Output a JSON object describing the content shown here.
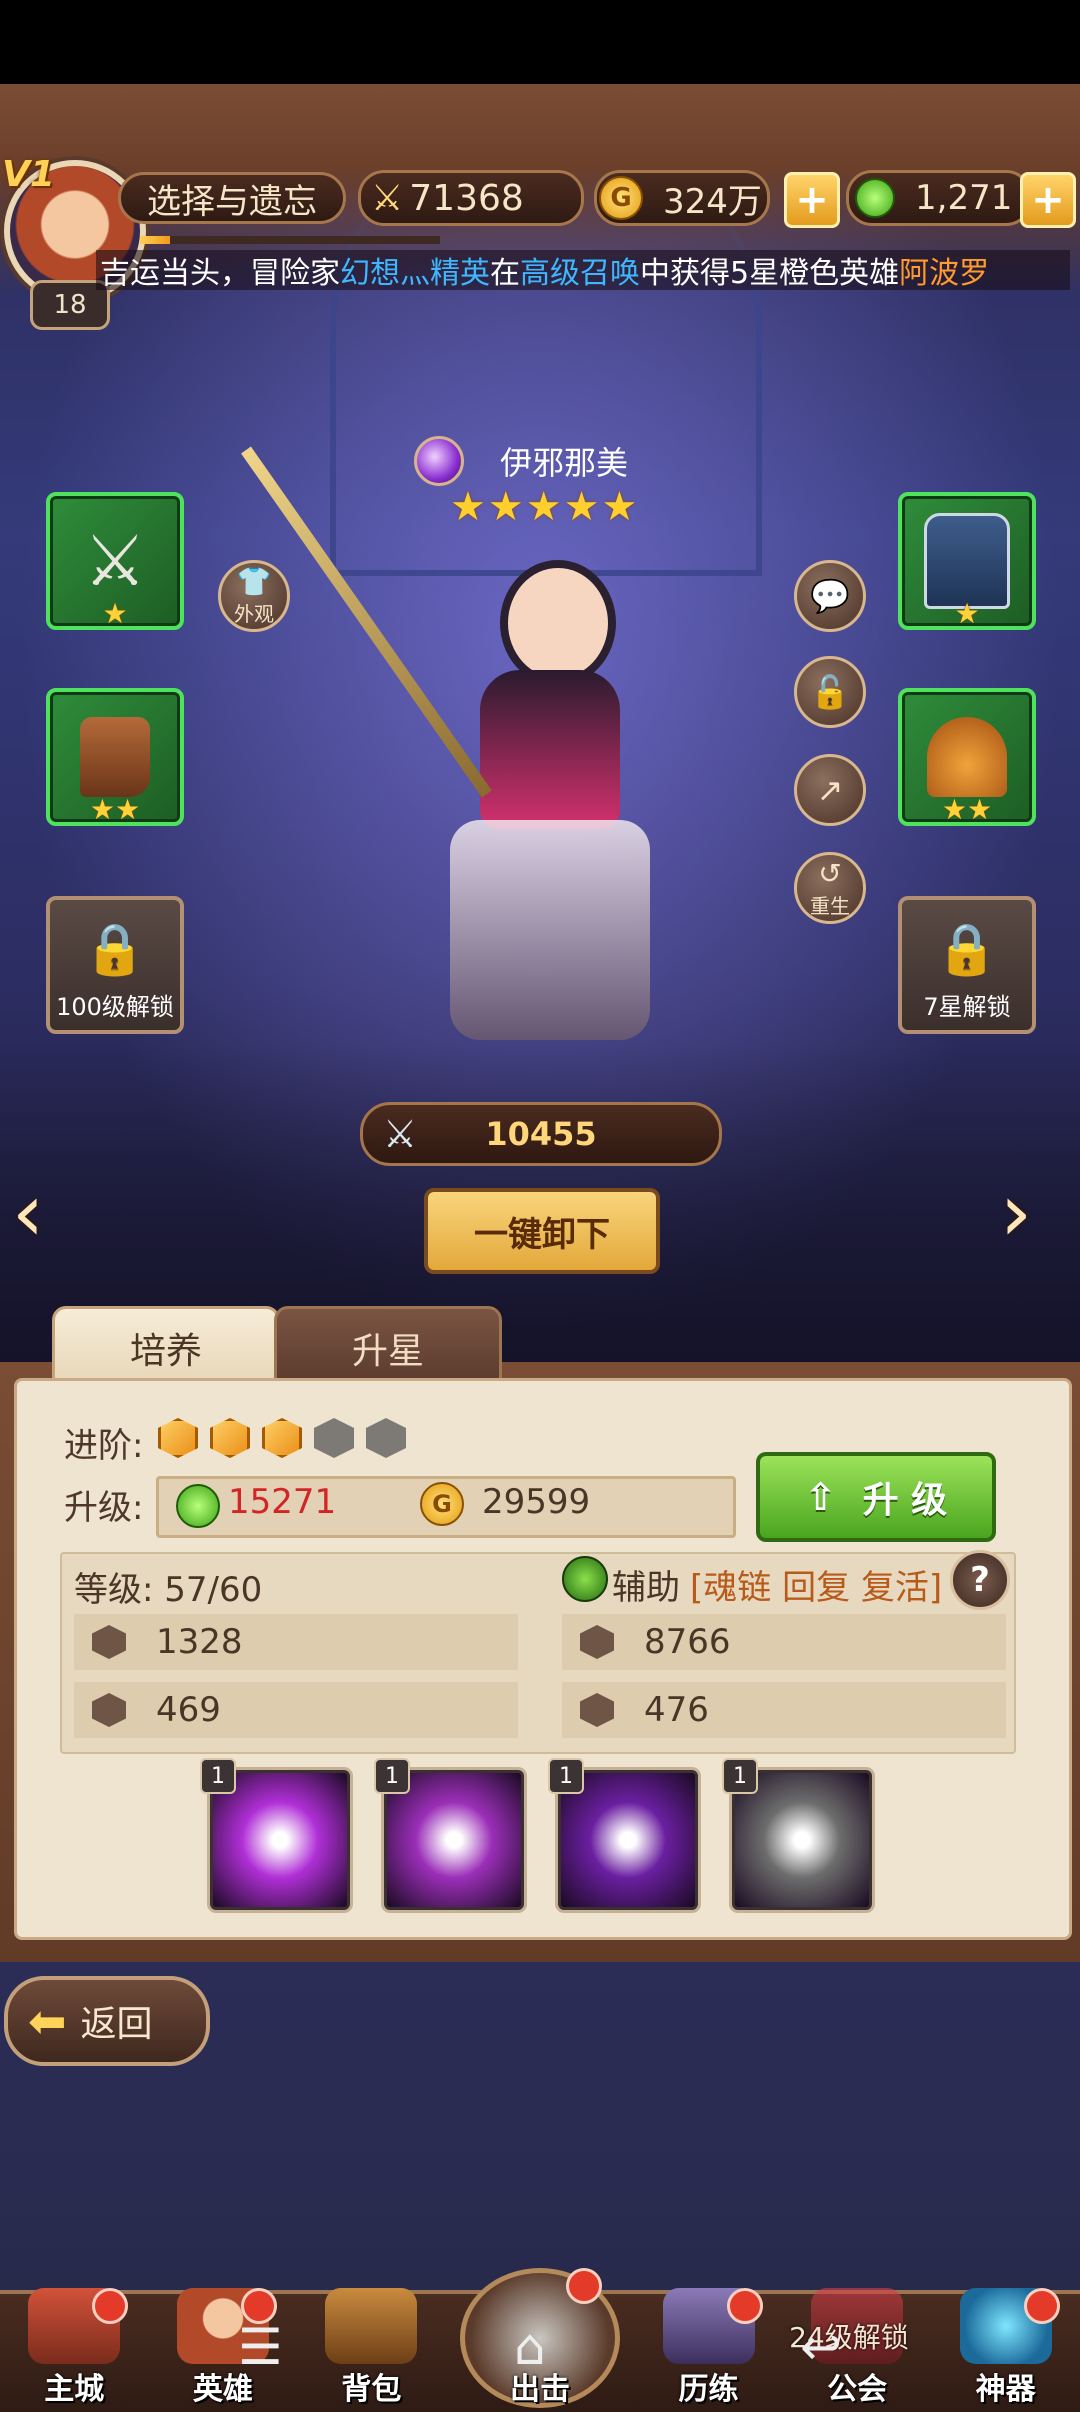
{
  "player": {
    "vip": "V1",
    "level": "18",
    "server_button": "选择与遗忘",
    "power": "71368",
    "gold": "324万",
    "potion": "1,271",
    "exp_fraction": 0.1
  },
  "marquee": {
    "prefix": "吉运当头，冒险家",
    "player_name": "幻想灬精英",
    "in_text": "在",
    "event": "高级召唤",
    "middle": "中获得5星橙色英雄",
    "hero": "阿波罗"
  },
  "hero": {
    "name": "伊邪那美",
    "stars": "★★★★★",
    "skin_button": "外观",
    "rebirth_label": "重生",
    "power": "10455",
    "unload_button": "一键卸下",
    "slot_lock_left": "100级解锁",
    "slot_lock_right": "7星解锁",
    "weapon_stars": "★",
    "armor_stars": "★",
    "boots_stars": "★★",
    "helmet_stars": "★★"
  },
  "tabs": [
    "培养",
    "升星"
  ],
  "panel": {
    "advance_label": "进阶:",
    "advance_gems_total": 5,
    "advance_gems_filled": 3,
    "upgrade_label": "升级:",
    "cost_potion": "15271",
    "cost_gold": "29599",
    "upgrade_button": "升 级",
    "level_text": "等级: 57/60",
    "role": "辅助",
    "tags": "[魂链 回复 复活]",
    "help": "?",
    "stats": {
      "attack": "1328",
      "hp": "8766",
      "defense": "469",
      "speed": "476"
    },
    "skills": [
      {
        "level": "1",
        "color": "#b02fd6"
      },
      {
        "level": "1",
        "color": "#9b2fb8"
      },
      {
        "level": "1",
        "color": "#6a1fa0"
      },
      {
        "level": "1",
        "color": "#6d6d6d"
      }
    ]
  },
  "back_button": "返回",
  "nav": [
    {
      "label": "主城"
    },
    {
      "label": "英雄"
    },
    {
      "label": "背包"
    },
    {
      "label": "出击"
    },
    {
      "label": "历练"
    },
    {
      "label": "公会"
    },
    {
      "label": "神器"
    }
  ],
  "nav_locked_text": "24级解锁",
  "colors": {
    "frame_brown": "#7a4d34",
    "panel_cream": "#efe4cf",
    "green_slot": "#2f8d3b",
    "accent_gold": "#ffd256",
    "name_blue": "#3fb7ff",
    "hero_orange": "#ff9a2e",
    "cost_red": "#d22525"
  }
}
